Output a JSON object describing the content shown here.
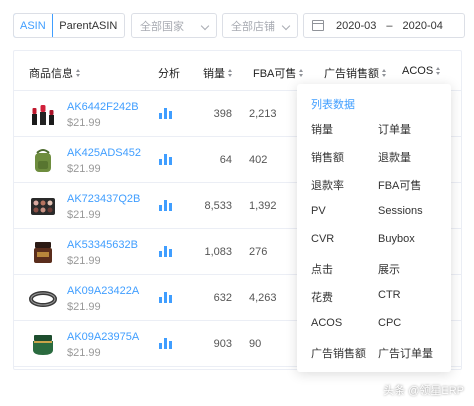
{
  "filters": {
    "asin_tab": "ASIN",
    "parent_asin_tab": "ParentASIN",
    "country_placeholder": "全部国家",
    "store_placeholder": "全部店铺",
    "date_start": "2020-03",
    "date_end": "2020-04",
    "date_separator": "–"
  },
  "columns": {
    "product": "商品信息",
    "analysis": "分析",
    "sales": "销量",
    "fba": "FBA可售",
    "ad_sales": "广告销售额",
    "acos": "ACOS"
  },
  "rows": [
    {
      "asin": "AK6442F242B",
      "price": "$21.99",
      "sales": "398",
      "fba": "2,213"
    },
    {
      "asin": "AK425ADS452",
      "price": "$21.99",
      "sales": "64",
      "fba": "402"
    },
    {
      "asin": "AK723437Q2B",
      "price": "$21.99",
      "sales": "8,533",
      "fba": "1,392"
    },
    {
      "asin": "AK53345632B",
      "price": "$21.99",
      "sales": "1,083",
      "fba": "276"
    },
    {
      "asin": "AK09A23422A",
      "price": "$21.99",
      "sales": "632",
      "fba": "4,263"
    },
    {
      "asin": "AK09A23975A",
      "price": "$21.99",
      "sales": "903",
      "fba": "90"
    }
  ],
  "column_panel": {
    "title": "列表数据",
    "items": [
      [
        "销量",
        "订单量"
      ],
      [
        "销售额",
        "退款量"
      ],
      [
        "退款率",
        "FBA可售"
      ],
      [
        "PV",
        "Sessions"
      ],
      [
        "CVR",
        "Buybox"
      ],
      [
        "点击",
        "展示"
      ],
      [
        "花费",
        "CTR"
      ],
      [
        "ACOS",
        "CPC"
      ],
      [
        "广告销售额",
        "广告订单量"
      ]
    ]
  },
  "watermark": "头条 @领星ERP",
  "colors": {
    "accent": "#409eff",
    "border": "#dcdfe6",
    "muted": "#999999"
  }
}
